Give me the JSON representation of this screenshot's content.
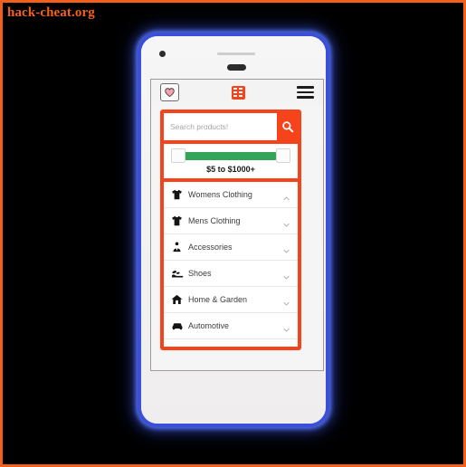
{
  "watermark": "hack-cheat.org",
  "theme": {
    "accent": "#f5441b",
    "slider_fill": "#33a559",
    "phone_border": "#3b4fd8",
    "page_border": "#f4601a",
    "background": "#000000"
  },
  "device": {
    "name": "android-phone-mockup",
    "camera": "camera-dot",
    "speaker": "earpiece-speaker"
  },
  "app": {
    "topbar": {
      "favorites_icon": "heart-icon",
      "apps_icon": "grid-icon",
      "menu_icon": "hamburger-menu-icon"
    },
    "search": {
      "placeholder": "Search products!",
      "value": "",
      "button_icon": "search-icon"
    },
    "price_filter": {
      "label": "$5 to $1000+",
      "min": "$5",
      "max": "$1000+",
      "fill_start_pct": 10,
      "fill_end_pct": 88
    },
    "categories": [
      {
        "label": "Womens Clothing",
        "icon": "tshirt-icon",
        "expanded": true,
        "chevron": "chevron-up-icon"
      },
      {
        "label": "Mens Clothing",
        "icon": "tshirt-icon",
        "expanded": false,
        "chevron": "chevron-down-icon"
      },
      {
        "label": "Accessories",
        "icon": "tie-icon",
        "expanded": false,
        "chevron": "chevron-down-icon"
      },
      {
        "label": "Shoes",
        "icon": "shoe-icon",
        "expanded": false,
        "chevron": "chevron-down-icon"
      },
      {
        "label": "Home & Garden",
        "icon": "home-icon",
        "expanded": false,
        "chevron": "chevron-down-icon"
      },
      {
        "label": "Automotive",
        "icon": "car-icon",
        "expanded": false,
        "chevron": "chevron-down-icon"
      }
    ]
  }
}
